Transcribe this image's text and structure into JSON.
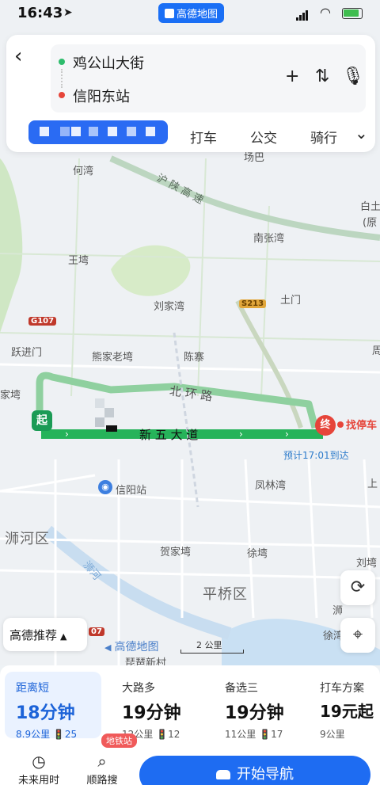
{
  "status": {
    "time": "16:43",
    "carrier_app": "高德地图",
    "carrier_logo_hint": "七星"
  },
  "route": {
    "from": "鸡公山大街",
    "to": "信阳东站"
  },
  "tabs": {
    "drive_label": "",
    "taxi": "打车",
    "transit": "公交",
    "bike": "骑行"
  },
  "map": {
    "places": {
      "hewan": "何湾",
      "wangwan": "王塆",
      "liujiawan": "刘家湾",
      "xiongjialaowan": "熊家老塆",
      "chenzhai": "陈寨",
      "yuejinmen": "跃进门",
      "jiawan": "家塆",
      "tumen": "土门",
      "nanzhangwan": "南张湾",
      "fenglinwan": "凤林湾",
      "hejiawan": "贺家塆",
      "xuwan": "徐塆",
      "baitugang": "白土垭",
      "yuan": "(原",
      "liuwan": "刘塆",
      "xuwan2": "徐湾",
      "shang": "上",
      "zhou": "周",
      "pipaxincun": "琵琶新村",
      "xinyangzhan": "信阳站",
      "shihequ": "浉河区",
      "pingqiaoqu": "平桥区",
      "shihe": "浉河",
      "shihe2": "浉",
      "jiabian": "场巴"
    },
    "roads": {
      "xinwudadao": "新 五 大 道",
      "beihuanlu": "北 环 路",
      "hushangaosu": "沪 陕 高 速"
    },
    "shields": {
      "g107": "G107",
      "s213": "S213",
      "g107b": "07"
    },
    "markers": {
      "start": "起",
      "end": "终",
      "parking": "找停车",
      "eta": "预计17:01到达"
    },
    "recommend_chip": "高德推荐",
    "logo": "高德地图",
    "scale": "2 公里"
  },
  "options": [
    {
      "label": "距离短",
      "duration": "18分钟",
      "distance": "8.9公里",
      "lights": "25",
      "selected": true
    },
    {
      "label": "大路多",
      "duration": "19分钟",
      "distance": "12公里",
      "lights": "12",
      "selected": false
    },
    {
      "label": "备选三",
      "duration": "19分钟",
      "distance": "11公里",
      "lights": "17",
      "selected": false
    },
    {
      "label": "打车方案",
      "duration": "19元起",
      "distance": "9公里",
      "lights": "",
      "selected": false
    }
  ],
  "nav": {
    "future": "未来用时",
    "along": "顺路搜",
    "subway_badge": "地铁站",
    "start": "开始导航"
  },
  "colors": {
    "route_green": "#26b35a",
    "accent_blue": "#1e6cf2",
    "end_red": "#e6453a"
  }
}
